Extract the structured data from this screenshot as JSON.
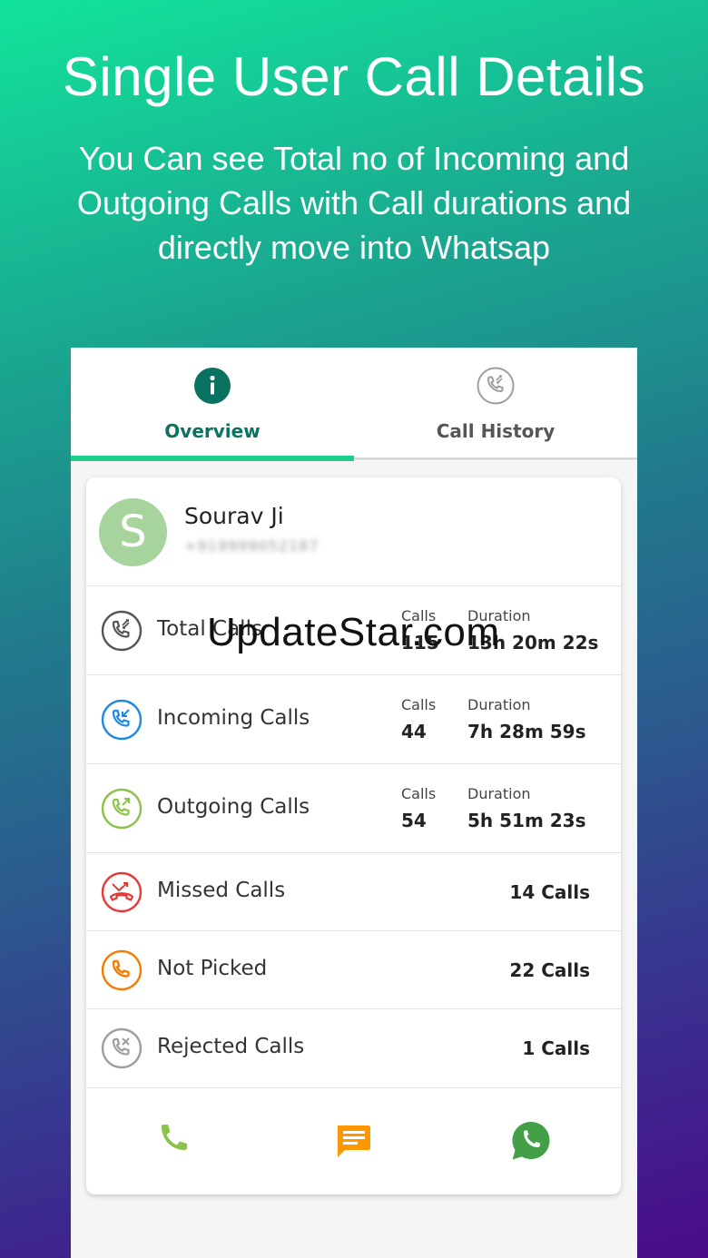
{
  "banner": {
    "title": "Single User Call Details",
    "subtitle_lines": [
      "You Can see Total no of Incoming and",
      "Outgoing Calls with Call durations and",
      "directly move into Whatsap"
    ]
  },
  "tabs": [
    {
      "label": "Overview",
      "icon": "info-icon",
      "active": true
    },
    {
      "label": "Call History",
      "icon": "call-history-icon",
      "active": false
    }
  ],
  "contact": {
    "initial": "S",
    "name": "Sourav Ji",
    "phone": "+919999052187",
    "avatar_color": "#a7d49c"
  },
  "stats": [
    {
      "label": "Total Calls",
      "icon": "total-calls-icon",
      "calls_caption": "Calls",
      "calls": "115",
      "duration_caption": "Duration",
      "duration": "13h 20m 22s",
      "color": "#555555"
    },
    {
      "label": "Incoming Calls",
      "icon": "incoming-call-icon",
      "calls_caption": "Calls",
      "calls": "44",
      "duration_caption": "Duration",
      "duration": "7h 28m 59s",
      "color": "#1e88e5"
    },
    {
      "label": "Outgoing Calls",
      "icon": "outgoing-call-icon",
      "calls_caption": "Calls",
      "calls": "54",
      "duration_caption": "Duration",
      "duration": "5h 51m 23s",
      "color": "#8bc34a"
    }
  ],
  "counts": [
    {
      "label": "Missed Calls",
      "icon": "missed-call-icon",
      "value": "14 Calls",
      "color": "#e53935"
    },
    {
      "label": "Not Picked",
      "icon": "not-picked-icon",
      "value": "22 Calls",
      "color": "#f57c00"
    },
    {
      "label": "Rejected Calls",
      "icon": "rejected-call-icon",
      "value": "1 Calls",
      "color": "#9e9e9e"
    }
  ],
  "actions": [
    {
      "name": "phone-icon",
      "color": "#8bc34a"
    },
    {
      "name": "message-icon",
      "color": "#ff9800"
    },
    {
      "name": "whatsapp-icon",
      "color": "#43a047"
    }
  ],
  "watermark": "UpdateStar.com",
  "colors": {
    "accent": "#1ecf8c",
    "tab_active_text": "#0a7260",
    "gradient_top": "#12e39b",
    "gradient_bottom": "#4a0b88"
  }
}
